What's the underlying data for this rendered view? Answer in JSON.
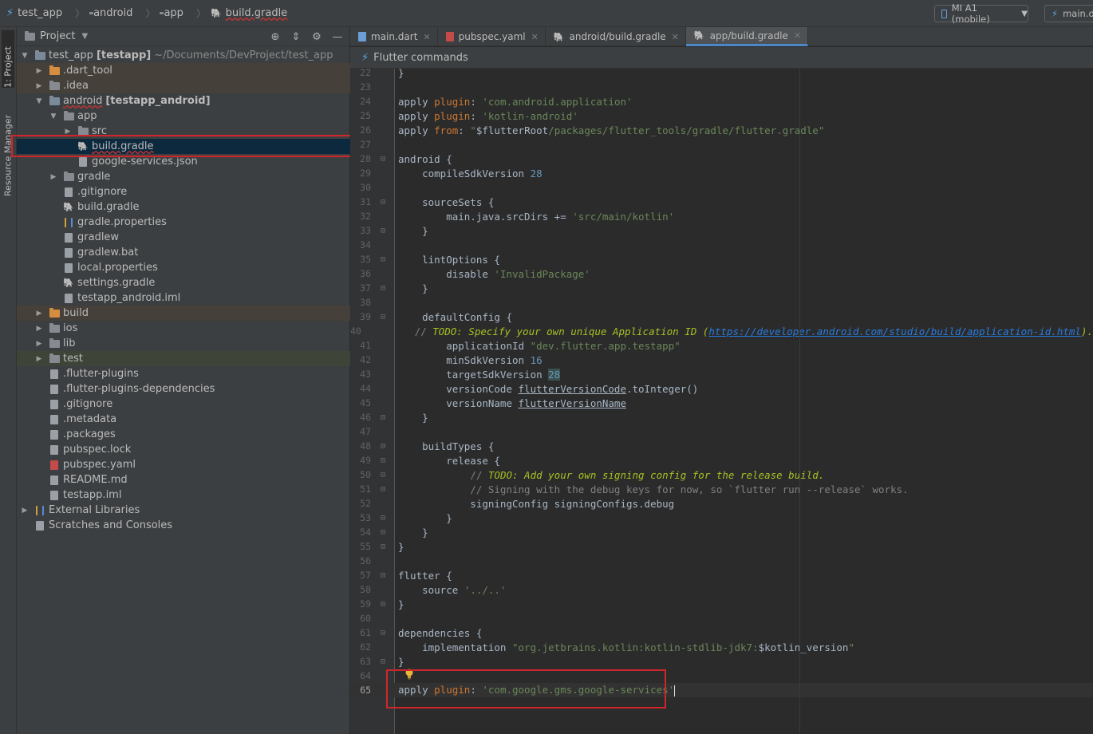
{
  "navbar": {
    "crumbs": [
      {
        "label": "test_app",
        "icon": "flutter-icon"
      },
      {
        "label": "android",
        "icon": "folder-icon"
      },
      {
        "label": "app",
        "icon": "folder-icon"
      },
      {
        "label": "build.gradle",
        "icon": "gradle-icon"
      }
    ],
    "device": "MI A1 (mobile)",
    "right_tab": "main.d"
  },
  "strip": {
    "project_label": "1: Project",
    "resource_label": "Resource Manager"
  },
  "project_panel": {
    "title": "Project",
    "tools": [
      "target-icon",
      "collapse-icon",
      "gear-icon",
      "minimize-icon"
    ],
    "tree": [
      {
        "indent": 0,
        "arrow": "down",
        "icon": "module-folder",
        "label": "test_app",
        "bold": "[testapp]",
        "dim": "~/Documents/DevProject/test_app"
      },
      {
        "indent": 1,
        "arrow": "right",
        "icon": "folder-orange",
        "label": ".dart_tool",
        "bg": "shaded"
      },
      {
        "indent": 1,
        "arrow": "right",
        "icon": "folder",
        "label": ".idea",
        "bg": "shaded"
      },
      {
        "indent": 1,
        "arrow": "down",
        "icon": "module-folder",
        "label": "android",
        "bold": "[testapp_android]"
      },
      {
        "indent": 2,
        "arrow": "down",
        "icon": "folder",
        "label": "app"
      },
      {
        "indent": 3,
        "arrow": "right",
        "icon": "folder",
        "label": "src"
      },
      {
        "indent": 3,
        "arrow": "none",
        "icon": "gradle",
        "label": "build.gradle",
        "bg": "sel"
      },
      {
        "indent": 3,
        "arrow": "none",
        "icon": "file",
        "label": "google-services.json"
      },
      {
        "indent": 2,
        "arrow": "right",
        "icon": "folder",
        "label": "gradle"
      },
      {
        "indent": 2,
        "arrow": "none",
        "icon": "file",
        "label": ".gitignore"
      },
      {
        "indent": 2,
        "arrow": "none",
        "icon": "gradle",
        "label": "build.gradle"
      },
      {
        "indent": 2,
        "arrow": "none",
        "icon": "bars",
        "label": "gradle.properties"
      },
      {
        "indent": 2,
        "arrow": "none",
        "icon": "file",
        "label": "gradlew"
      },
      {
        "indent": 2,
        "arrow": "none",
        "icon": "file",
        "label": "gradlew.bat"
      },
      {
        "indent": 2,
        "arrow": "none",
        "icon": "file",
        "label": "local.properties"
      },
      {
        "indent": 2,
        "arrow": "none",
        "icon": "gradle",
        "label": "settings.gradle"
      },
      {
        "indent": 2,
        "arrow": "none",
        "icon": "file",
        "label": "testapp_android.iml"
      },
      {
        "indent": 1,
        "arrow": "right",
        "icon": "folder-orange",
        "label": "build",
        "bg": "shaded"
      },
      {
        "indent": 1,
        "arrow": "right",
        "icon": "folder",
        "label": "ios"
      },
      {
        "indent": 1,
        "arrow": "right",
        "icon": "folder",
        "label": "lib"
      },
      {
        "indent": 1,
        "arrow": "right",
        "icon": "folder",
        "label": "test",
        "bg": "shaded2"
      },
      {
        "indent": 1,
        "arrow": "none",
        "icon": "file",
        "label": ".flutter-plugins"
      },
      {
        "indent": 1,
        "arrow": "none",
        "icon": "file",
        "label": ".flutter-plugins-dependencies"
      },
      {
        "indent": 1,
        "arrow": "none",
        "icon": "file",
        "label": ".gitignore"
      },
      {
        "indent": 1,
        "arrow": "none",
        "icon": "file",
        "label": ".metadata"
      },
      {
        "indent": 1,
        "arrow": "none",
        "icon": "file",
        "label": ".packages"
      },
      {
        "indent": 1,
        "arrow": "none",
        "icon": "file",
        "label": "pubspec.lock"
      },
      {
        "indent": 1,
        "arrow": "none",
        "icon": "yaml",
        "label": "pubspec.yaml"
      },
      {
        "indent": 1,
        "arrow": "none",
        "icon": "file",
        "label": "README.md"
      },
      {
        "indent": 1,
        "arrow": "none",
        "icon": "file",
        "label": "testapp.iml"
      },
      {
        "indent": 0,
        "arrow": "right",
        "icon": "bars",
        "label": "External Libraries"
      },
      {
        "indent": 0,
        "arrow": "none",
        "icon": "file",
        "label": "Scratches and Consoles"
      }
    ]
  },
  "tabs": [
    {
      "label": "main.dart",
      "icon": "dart-file-icon",
      "active": false
    },
    {
      "label": "pubspec.yaml",
      "icon": "yaml-file-icon",
      "active": false
    },
    {
      "label": "android/build.gradle",
      "icon": "gradle-icon",
      "active": false
    },
    {
      "label": "app/build.gradle",
      "icon": "gradle-icon",
      "active": true
    }
  ],
  "cmdbar": {
    "label": "Flutter commands"
  },
  "editor": {
    "lines": [
      {
        "n": "22",
        "fold": "",
        "segs": [
          [
            "plain",
            "}"
          ]
        ]
      },
      {
        "n": "23",
        "fold": "",
        "segs": []
      },
      {
        "n": "24",
        "fold": "",
        "segs": [
          [
            "plain",
            "apply "
          ],
          [
            "kw",
            "plugin"
          ],
          [
            "plain",
            ": "
          ],
          [
            "str",
            "'com.android.application'"
          ]
        ]
      },
      {
        "n": "25",
        "fold": "",
        "segs": [
          [
            "plain",
            "apply "
          ],
          [
            "kw",
            "plugin"
          ],
          [
            "plain",
            ": "
          ],
          [
            "str",
            "'kotlin-android'"
          ]
        ]
      },
      {
        "n": "26",
        "fold": "",
        "segs": [
          [
            "plain",
            "apply "
          ],
          [
            "kw",
            "from"
          ],
          [
            "plain",
            ": "
          ],
          [
            "str",
            "\""
          ],
          [
            "plain",
            "$flutterRoot"
          ],
          [
            "str",
            "/packages/flutter_tools/gradle/flutter.gradle\""
          ]
        ]
      },
      {
        "n": "27",
        "fold": "",
        "segs": []
      },
      {
        "n": "28",
        "fold": "⊟",
        "segs": [
          [
            "plain",
            "android {"
          ]
        ]
      },
      {
        "n": "29",
        "fold": "",
        "segs": [
          [
            "plain",
            "    compileSdkVersion "
          ],
          [
            "num-lit",
            "28"
          ]
        ]
      },
      {
        "n": "30",
        "fold": "",
        "segs": []
      },
      {
        "n": "31",
        "fold": "⊟",
        "segs": [
          [
            "plain",
            "    sourceSets {"
          ]
        ]
      },
      {
        "n": "32",
        "fold": "",
        "segs": [
          [
            "plain",
            "        main.java.srcDirs += "
          ],
          [
            "str",
            "'src/main/kotlin'"
          ]
        ]
      },
      {
        "n": "33",
        "fold": "⊟",
        "segs": [
          [
            "plain",
            "    }"
          ]
        ]
      },
      {
        "n": "34",
        "fold": "",
        "segs": []
      },
      {
        "n": "35",
        "fold": "⊟",
        "segs": [
          [
            "plain",
            "    lintOptions {"
          ]
        ]
      },
      {
        "n": "36",
        "fold": "",
        "segs": [
          [
            "plain",
            "        disable "
          ],
          [
            "str",
            "'InvalidPackage'"
          ]
        ]
      },
      {
        "n": "37",
        "fold": "⊟",
        "segs": [
          [
            "plain",
            "    }"
          ]
        ]
      },
      {
        "n": "38",
        "fold": "",
        "segs": []
      },
      {
        "n": "39",
        "fold": "⊟",
        "segs": [
          [
            "plain",
            "    defaultConfig {"
          ]
        ]
      },
      {
        "n": "40",
        "fold": "",
        "segs": [
          [
            "cmt",
            "        // "
          ],
          [
            "todo",
            "TODO: Specify your own unique Application ID ("
          ],
          [
            "link",
            "https://developer.android.com/studio/build/application-id.html"
          ],
          [
            "todo",
            ")."
          ]
        ]
      },
      {
        "n": "41",
        "fold": "",
        "segs": [
          [
            "plain",
            "        applicationId "
          ],
          [
            "str",
            "\"dev.flutter.app.testapp\""
          ]
        ]
      },
      {
        "n": "42",
        "fold": "",
        "segs": [
          [
            "plain",
            "        minSdkVersion "
          ],
          [
            "num-lit",
            "16"
          ]
        ]
      },
      {
        "n": "43",
        "fold": "",
        "segs": [
          [
            "plain",
            "        targetSdkVersion "
          ],
          [
            "hl num-lit",
            "28"
          ]
        ]
      },
      {
        "n": "44",
        "fold": "",
        "segs": [
          [
            "plain",
            "        versionCode "
          ],
          [
            "ul",
            "flutterVersionCode"
          ],
          [
            "plain",
            ".toInteger()"
          ]
        ]
      },
      {
        "n": "45",
        "fold": "",
        "segs": [
          [
            "plain",
            "        versionName "
          ],
          [
            "ul",
            "flutterVersionName"
          ]
        ]
      },
      {
        "n": "46",
        "fold": "⊟",
        "segs": [
          [
            "plain",
            "    }"
          ]
        ]
      },
      {
        "n": "47",
        "fold": "",
        "segs": []
      },
      {
        "n": "48",
        "fold": "⊟",
        "segs": [
          [
            "plain",
            "    buildTypes {"
          ]
        ]
      },
      {
        "n": "49",
        "fold": "⊟",
        "segs": [
          [
            "plain",
            "        release {"
          ]
        ]
      },
      {
        "n": "50",
        "fold": "⊟",
        "segs": [
          [
            "cmt",
            "            // "
          ],
          [
            "todo",
            "TODO: Add your own signing config for the release build."
          ]
        ]
      },
      {
        "n": "51",
        "fold": "⊟",
        "segs": [
          [
            "cmt",
            "            // Signing with the debug keys for now, so `flutter run --release` works."
          ]
        ]
      },
      {
        "n": "52",
        "fold": "",
        "segs": [
          [
            "plain",
            "            signingConfig signingConfigs.debug"
          ]
        ]
      },
      {
        "n": "53",
        "fold": "⊟",
        "segs": [
          [
            "plain",
            "        }"
          ]
        ]
      },
      {
        "n": "54",
        "fold": "⊟",
        "segs": [
          [
            "plain",
            "    }"
          ]
        ]
      },
      {
        "n": "55",
        "fold": "⊟",
        "segs": [
          [
            "plain",
            "}"
          ]
        ]
      },
      {
        "n": "56",
        "fold": "",
        "segs": []
      },
      {
        "n": "57",
        "fold": "⊟",
        "segs": [
          [
            "plain",
            "flutter {"
          ]
        ]
      },
      {
        "n": "58",
        "fold": "",
        "segs": [
          [
            "plain",
            "    source "
          ],
          [
            "str",
            "'../..'"
          ]
        ]
      },
      {
        "n": "59",
        "fold": "⊟",
        "segs": [
          [
            "plain",
            "}"
          ]
        ]
      },
      {
        "n": "60",
        "fold": "",
        "segs": []
      },
      {
        "n": "61",
        "fold": "⊟",
        "segs": [
          [
            "plain",
            "dependencies {"
          ]
        ]
      },
      {
        "n": "62",
        "fold": "",
        "segs": [
          [
            "plain",
            "    implementation "
          ],
          [
            "str",
            "\"org.jetbrains.kotlin:kotlin-stdlib-jdk7:"
          ],
          [
            "plain",
            "$kotlin_version"
          ],
          [
            "str",
            "\""
          ]
        ]
      },
      {
        "n": "63",
        "fold": "⊟",
        "segs": [
          [
            "plain",
            "}"
          ]
        ]
      },
      {
        "n": "64",
        "fold": "",
        "segs": []
      },
      {
        "n": "65",
        "fold": "",
        "segs": [
          [
            "plain",
            "apply "
          ],
          [
            "kw",
            "plugin"
          ],
          [
            "plain",
            ": "
          ],
          [
            "str",
            "'com.google.gms.google-services'"
          ]
        ],
        "current": true
      }
    ]
  }
}
